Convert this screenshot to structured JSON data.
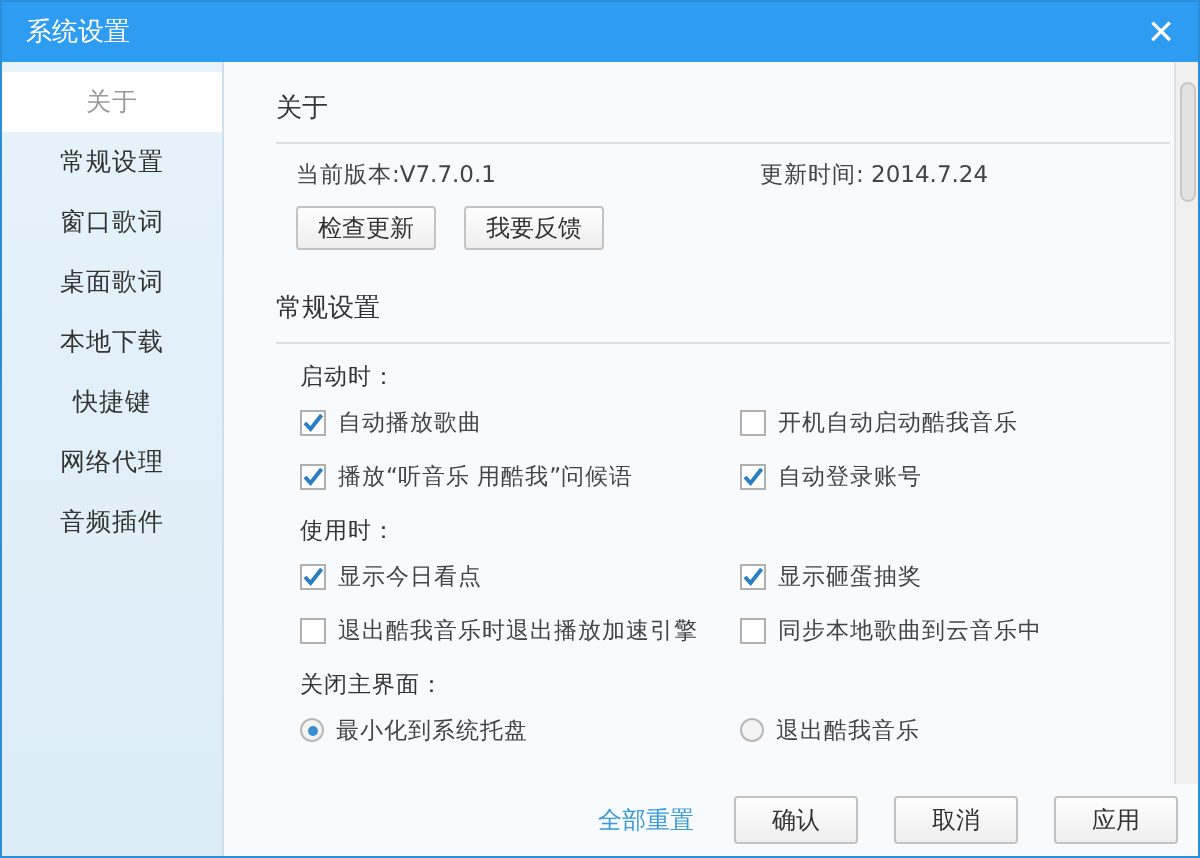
{
  "window": {
    "title": "系统设置",
    "close": "×"
  },
  "sidebar": {
    "items": [
      {
        "label": "关于",
        "selected": true
      },
      {
        "label": "常规设置",
        "selected": false
      },
      {
        "label": "窗口歌词",
        "selected": false
      },
      {
        "label": "桌面歌词",
        "selected": false
      },
      {
        "label": "本地下载",
        "selected": false
      },
      {
        "label": "快捷键",
        "selected": false
      },
      {
        "label": "网络代理",
        "selected": false
      },
      {
        "label": "音频插件",
        "selected": false
      }
    ]
  },
  "about": {
    "title": "关于",
    "version": "当前版本:V7.7.0.1",
    "update_time": "更新时间: 2014.7.24",
    "buttons": [
      "检查更新",
      "我要反馈"
    ]
  },
  "general": {
    "title": "常规设置",
    "groups": [
      {
        "label": "启动时：",
        "options": [
          {
            "kind": "checkbox",
            "label": "自动播放歌曲",
            "checked": true
          },
          {
            "kind": "checkbox",
            "label": "开机自动启动酷我音乐",
            "checked": false
          },
          {
            "kind": "checkbox",
            "label": "播放“听音乐 用酷我”问候语",
            "checked": true
          },
          {
            "kind": "checkbox",
            "label": "自动登录账号",
            "checked": true
          }
        ]
      },
      {
        "label": "使用时：",
        "options": [
          {
            "kind": "checkbox",
            "label": "显示今日看点",
            "checked": true
          },
          {
            "kind": "checkbox",
            "label": "显示砸蛋抽奖",
            "checked": true
          },
          {
            "kind": "checkbox",
            "label": "退出酷我音乐时退出播放加速引擎",
            "checked": false
          },
          {
            "kind": "checkbox",
            "label": "同步本地歌曲到云音乐中",
            "checked": false
          }
        ]
      },
      {
        "label": "关闭主界面：",
        "options": [
          {
            "kind": "radio",
            "label": "最小化到系统托盘",
            "checked": true
          },
          {
            "kind": "radio",
            "label": "退出酷我音乐",
            "checked": false
          }
        ]
      }
    ]
  },
  "footer": {
    "reset_link": "全部重置",
    "buttons": [
      "确认",
      "取消",
      "应用"
    ]
  }
}
